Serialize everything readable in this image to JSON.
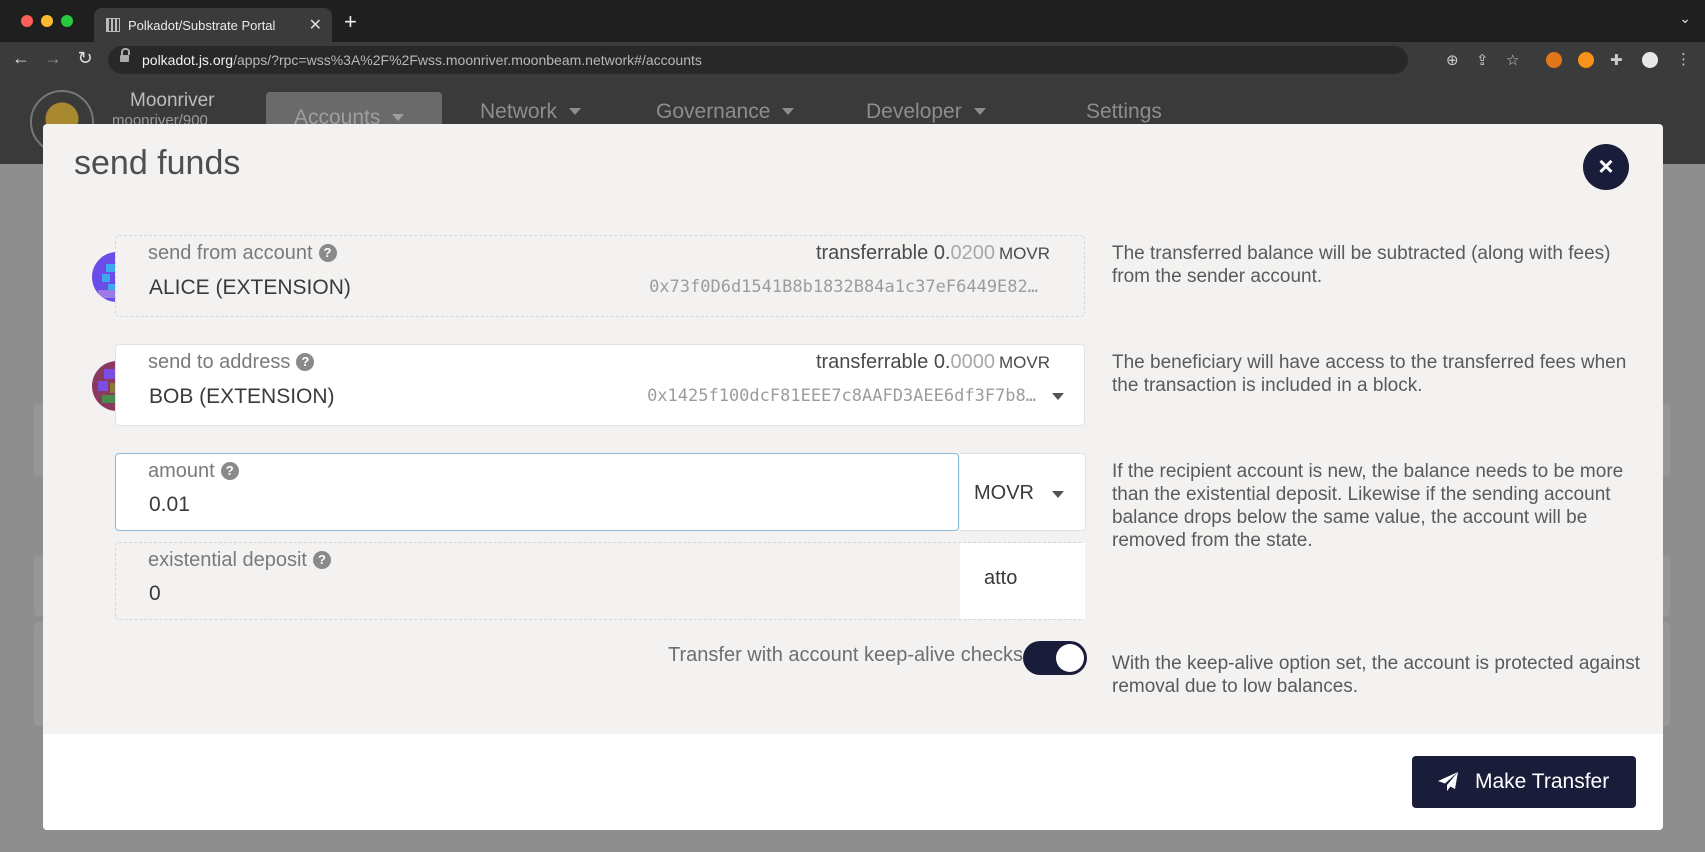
{
  "browser": {
    "tab_title": "Polkadot/Substrate Portal",
    "tab_close": "✕",
    "new_tab": "+",
    "url_host": "polkadot.js.org",
    "url_path": "/apps/?rpc=wss%3A%2F%2Fwss.moonriver.moonbeam.network#/accounts"
  },
  "app": {
    "chain_name": "Moonriver",
    "chain_sub": "moonriver/900",
    "nav": [
      "Accounts",
      "Network",
      "Governance",
      "Developer",
      "Settings"
    ]
  },
  "modal": {
    "title": "send funds",
    "close": "×",
    "from": {
      "label": "send from account",
      "name": "ALICE (EXTENSION)",
      "balance_label": "transferrable ",
      "balance_int": "0.",
      "balance_frac": "0200",
      "unit": "MOVR",
      "address": "0x73f0D6d1541B8b1832B84a1c37eF6449E82…",
      "help": "The transferred balance will be subtracted (along with fees) from the sender account."
    },
    "to": {
      "label": "send to address",
      "name": "BOB (EXTENSION)",
      "balance_label": "transferrable ",
      "balance_int": "0.",
      "balance_frac": "0000",
      "unit": "MOVR",
      "address": "0x1425f100dcF81EEE7c8AAFD3AEE6df3F7b8…",
      "help": "The beneficiary will have access to the transferred fees when the transaction is included in a block."
    },
    "amount": {
      "label": "amount",
      "value": "0.01",
      "unit": "MOVR",
      "help": "If the recipient account is new, the balance needs to be more than the existential deposit. Likewise if the sending account balance drops below the same value, the account will be removed from the state."
    },
    "existential": {
      "label": "existential deposit",
      "value": "0",
      "unit": "atto"
    },
    "keepalive": {
      "label": "Transfer with account keep-alive checks",
      "enabled": true,
      "help": "With the keep-alive option set, the account is protected against removal due to low balances."
    },
    "submit": "Make Transfer"
  },
  "colors": {
    "accent": "#1a1d3a",
    "focus_border": "#8bb9dc"
  }
}
